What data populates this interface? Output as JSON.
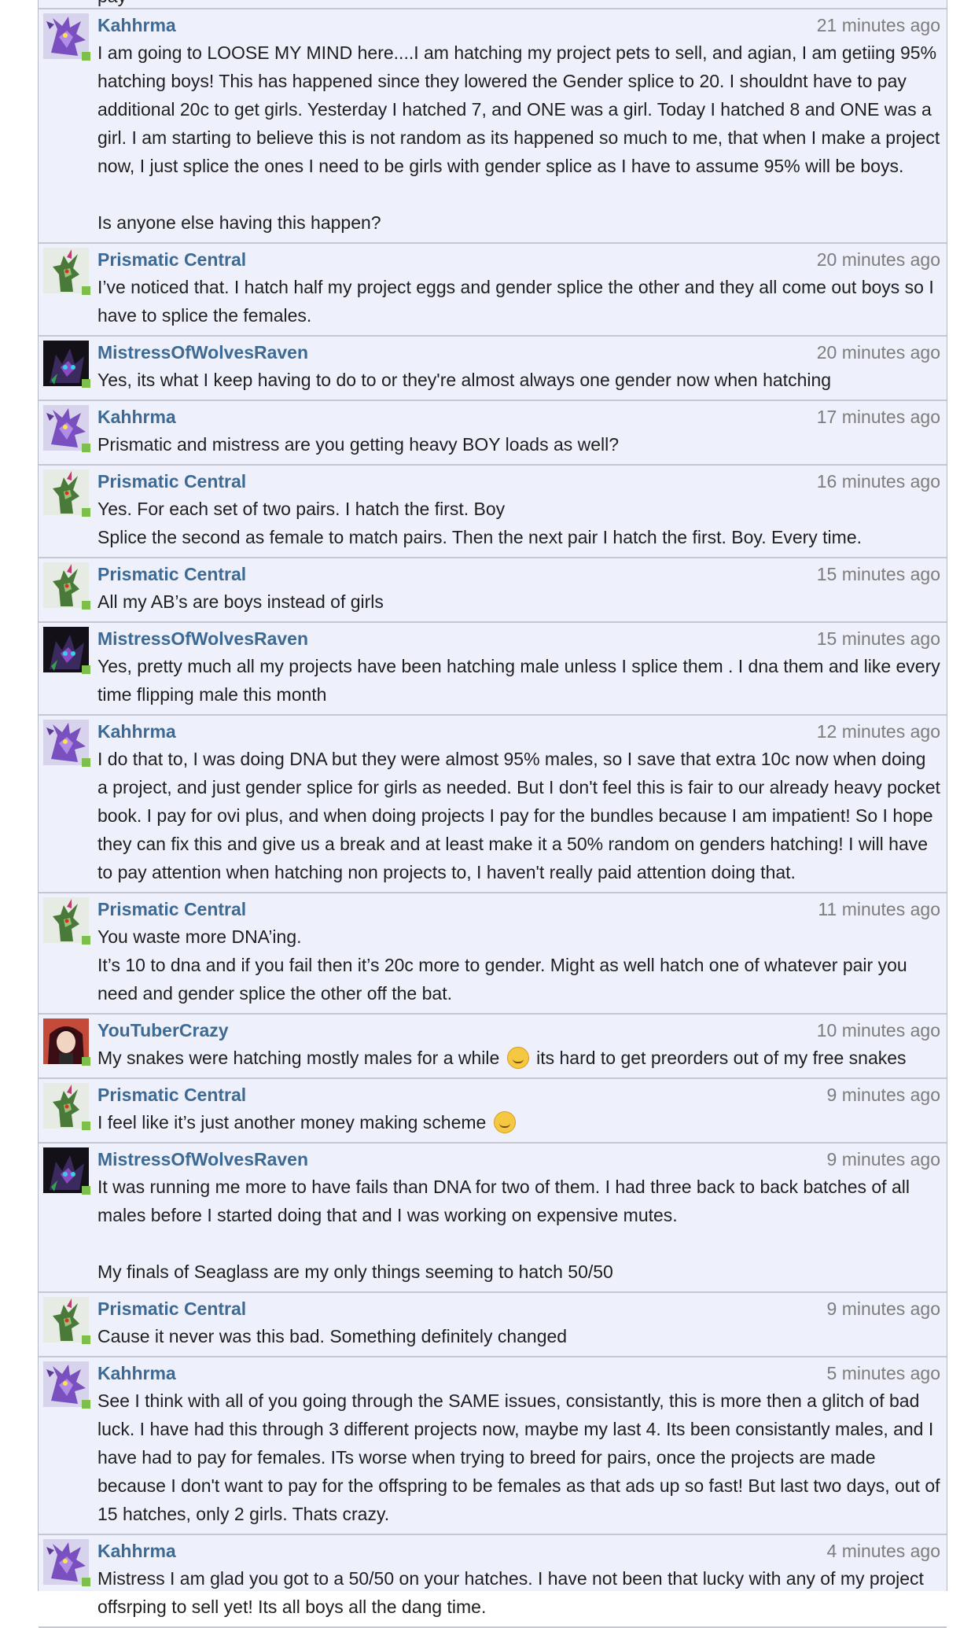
{
  "thread": {
    "top_partial_text": "pay",
    "posts": [
      {
        "user": "Kahhrma",
        "avatar": "purple-dragon",
        "time": "21 minutes ago",
        "paragraphs": [
          "I am going to LOOSE MY MIND here....I am hatching my project pets to sell, and agian, I am getiing 95% hatching boys! This has happened since they lowered the Gender splice to 20. I shouldnt have to pay additional 20c to get girls. Yesterday I hatched 7, and ONE was a girl. Today I hatched 8 and ONE was a girl. I am starting to believe this is not random as its happened so much to me, that when I make a project now, I just splice the ones I need to be girls with gender splice as I have to assume 95% will be boys.",
          "",
          "Is anyone else having this happen?"
        ]
      },
      {
        "user": "Prismatic Central",
        "avatar": "green-dragon",
        "time": "20 minutes ago",
        "paragraphs": [
          "I’ve noticed that. I hatch half my project eggs and gender splice the other and they all come out boys so I have to splice the females."
        ]
      },
      {
        "user": "MistressOfWolvesRaven",
        "avatar": "dark-wolf",
        "time": "20 minutes ago",
        "paragraphs": [
          "Yes, its what I keep having to do to or they're almost always one gender now when hatching"
        ]
      },
      {
        "user": "Kahhrma",
        "avatar": "purple-dragon",
        "time": "17 minutes ago",
        "paragraphs": [
          "Prismatic and mistress are you getting heavy BOY loads as well?"
        ]
      },
      {
        "user": "Prismatic Central",
        "avatar": "green-dragon",
        "time": "16 minutes ago",
        "paragraphs": [
          "Yes. For each set of two pairs. I hatch the first. Boy",
          "Splice the second as female to match pairs. Then the next pair I hatch the first. Boy. Every time."
        ]
      },
      {
        "user": "Prismatic Central",
        "avatar": "green-dragon",
        "time": "15 minutes ago",
        "paragraphs": [
          "All my AB’s are boys instead of girls"
        ]
      },
      {
        "user": "MistressOfWolvesRaven",
        "avatar": "dark-wolf",
        "time": "15 minutes ago",
        "paragraphs": [
          "Yes, pretty much all my projects have been hatching male unless I splice them . I dna them and like every time flipping male this month"
        ]
      },
      {
        "user": "Kahhrma",
        "avatar": "purple-dragon",
        "time": "12 minutes ago",
        "paragraphs": [
          "I do that to, I was doing DNA but they were almost 95% males, so I save that extra 10c now when doing a project, and just gender splice for girls as needed. But I don't feel this is fair to our already heavy pocket book. I pay for ovi plus, and when doing projects I pay for the bundles because I am impatient! So I hope they can fix this and give us a break and at least make it a 50% random on genders hatching! I will have to pay attention when hatching non projects to, I haven't really paid attention doing that."
        ]
      },
      {
        "user": "Prismatic Central",
        "avatar": "green-dragon",
        "time": "11 minutes ago",
        "paragraphs": [
          "You waste more DNA’ing.",
          "It’s 10 to dna and if you fail then it’s 20c more to gender. Might as well hatch one of whatever pair you need and gender splice the other off the bat."
        ]
      },
      {
        "user": "YouTuberCrazy",
        "avatar": "red-hair-girl",
        "time": "10 minutes ago",
        "paragraphs": [
          "My snakes were hatching mostly males for a while [emoji] its hard to get preorders out of my free snakes"
        ]
      },
      {
        "user": "Prismatic Central",
        "avatar": "green-dragon",
        "time": "9 minutes ago",
        "paragraphs": [
          "I feel like it’s just another money making scheme [emoji]"
        ]
      },
      {
        "user": "MistressOfWolvesRaven",
        "avatar": "dark-wolf",
        "time": "9 minutes ago",
        "paragraphs": [
          "It was running me more to have fails than DNA for two of them. I had three back to back batches of all males before I started doing that and I was working on expensive mutes.",
          "",
          "My finals of Seaglass are my only things seeming to hatch 50/50"
        ]
      },
      {
        "user": "Prismatic Central",
        "avatar": "green-dragon",
        "time": "9 minutes ago",
        "paragraphs": [
          "Cause it never was this bad. Something definitely changed"
        ]
      },
      {
        "user": "Kahhrma",
        "avatar": "purple-dragon",
        "time": "5 minutes ago",
        "paragraphs": [
          "See I think with all of you going through the SAME issues, consistantly, this is more then a glitch of bad luck. I have had this through 3 different projects now, maybe my last 4. Its been consistantly males, and I have had to pay for females. ITs worse when trying to breed for pairs, once the projects are made because I don't want to pay for the offspring to be females as that ads up so fast! But last two days, out of 15 hatches, only 2 girls. Thats crazy."
        ]
      },
      {
        "user": "Kahhrma",
        "avatar": "purple-dragon",
        "time": "4 minutes ago",
        "paragraphs": [
          "Mistress I am glad you got to a 50/50 on your hatches. I have not been that lucky with any of my project offsrping to sell yet! Its all boys all the dang time."
        ]
      }
    ]
  },
  "colors": {
    "username": "#3d6a94",
    "timestamp": "#7d7d7d",
    "panel_bg": "#eef0fb",
    "online": "#7cbf4a"
  }
}
